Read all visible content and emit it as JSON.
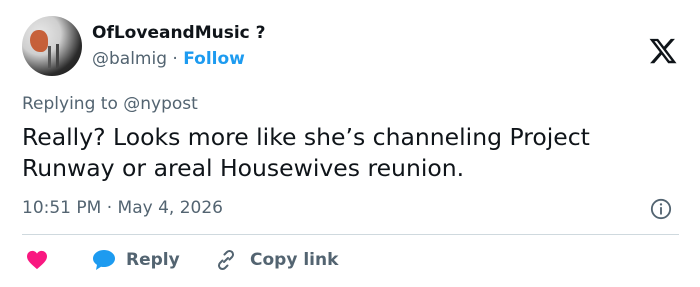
{
  "author": {
    "display_name": "OfLoveandMusic ?",
    "handle": "@balmig",
    "separator": "·",
    "follow_label": "Follow"
  },
  "tweet": {
    "replying_to_prefix": "Replying to ",
    "replying_to_handle": "@nypost",
    "text": "Really? Looks more like she’s channeling Project Runway or areal Housewives reunion.",
    "time": "10:51 PM",
    "date_separator": "·",
    "date": "May 4, 2026"
  },
  "actions": {
    "reply_label": "Reply",
    "copy_link_label": "Copy link"
  },
  "icons": {
    "brand": "x-logo-icon",
    "info": "info-icon",
    "like": "heart-icon",
    "reply": "reply-bubble-icon",
    "copy": "link-icon"
  },
  "colors": {
    "link_blue": "#1d9bf0",
    "heart_pink": "#f91880",
    "secondary_text": "#536471",
    "primary_text": "#0f1419"
  }
}
